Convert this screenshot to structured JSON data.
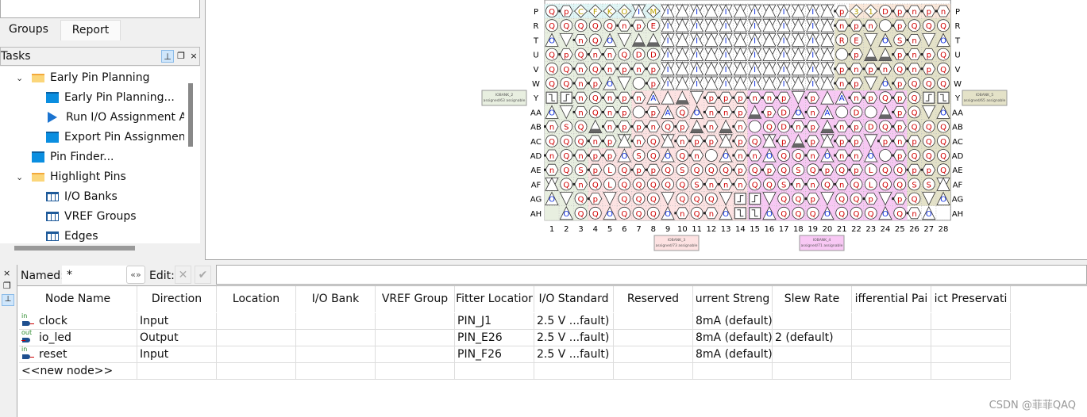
{
  "left_panel": {
    "tabs": [
      {
        "label": "Groups"
      },
      {
        "label": "Report",
        "active": true
      }
    ],
    "tasks": {
      "title": "Tasks",
      "items": [
        {
          "label": "Early Pin Planning",
          "icon": "folder-icon",
          "expanded": true,
          "level": 1
        },
        {
          "label": "Early Pin Planning...",
          "icon": "window-icon",
          "level": 2
        },
        {
          "label": "Run I/O Assignment A",
          "icon": "play-icon",
          "level": 2
        },
        {
          "label": "Export Pin Assignmen",
          "icon": "window-icon",
          "level": 2
        },
        {
          "label": "Pin Finder...",
          "icon": "window-icon",
          "level": 1
        },
        {
          "label": "Highlight Pins",
          "icon": "folder-icon",
          "expanded": true,
          "level": 1
        },
        {
          "label": "I/O Banks",
          "icon": "table-icon",
          "level": 2
        },
        {
          "label": "VREF Groups",
          "icon": "table-icon",
          "level": 2
        },
        {
          "label": "Edges",
          "icon": "table-icon",
          "level": 2
        }
      ]
    }
  },
  "package": {
    "row_labels": [
      "P",
      "R",
      "T",
      "U",
      "V",
      "W",
      "Y",
      "AA",
      "AB",
      "AC",
      "AD",
      "AE",
      "AF",
      "AG",
      "AH"
    ],
    "col_labels": [
      "1",
      "2",
      "3",
      "4",
      "5",
      "6",
      "7",
      "8",
      "9",
      "10",
      "11",
      "12",
      "13",
      "14",
      "15",
      "16",
      "17",
      "18",
      "19",
      "20",
      "21",
      "22",
      "23",
      "24",
      "25",
      "26",
      "27",
      "28"
    ],
    "rows": [
      "Q p C F K O I M I X I X I X I X I X I X p 3 1 D p n p n",
      "Q Q Q Q Q n p E I X I X I X I X I X I X n p n o p Q Q Q",
      "O^ v n Q O^ v T T I X I X I X I X I X I X R E v O^ S n v O^",
      "Q p Q n n Q D D I X I X I X I X I X I X o p T T p n p Q",
      "Q Q n Q n p n p I X I X I X I X I X I X p n p n Q n p Q",
      "Q Q n p O^ v o p I X I X I X I X I X I X n p v O^ p Q Q Q",
      "Cf Cr n Q n p n A^ ^ T v p p p n n p v p ^ A^ n p Q p Q Cr Cf",
      "O^ v n Q n p o p A^ Q O^ n n p T p D O^ n A^ o D o T p Q v O^",
      "n S Q T n p p n Q p T n T n o Q D n p T n p D Q p Q Q Q",
      "Q Q Q n p X n Q X n p p X p Q X p T p X p p v p n p Q Q",
      "n Q n p p O^ S Q O^ Q n o O^ n n O^ Q Q n O^ n n O^ o p Q Q Q",
      "n Q S p L Q p p Q S Q Q Q p Q p Q S Q p Q p L Q Q p p Q",
      "X Q n Q L Q Q Q Q Q S n n n Q Q S n n Q n Q L Q Q S S X",
      "O^ v Q p v Q Q Q v Q Q Q v Cr Cr v Q Q p v Q Q p v p Q v O^",
      "_ O^ Q Q O^ Q Q Q O^ n Q n O^ Cf Cf O^ Q Q Q O^ Q Q Q O^ Q n O^ _"
    ],
    "banks": [
      {
        "name": "IOBANK_2",
        "status": "assigned/63 assignable",
        "color": "#e8efe0"
      },
      {
        "name": "IOBANK_5",
        "status": "assigned/65 assignable",
        "color": "#e4e2c8"
      },
      {
        "name": "IOBANK_3",
        "status": "assigned/73 assignable",
        "color": "#fde2e2"
      },
      {
        "name": "IOBANK_4",
        "status": "assigned/71 assignable",
        "color": "#f8c8f4"
      }
    ],
    "colors": {
      "Q": "#d00000",
      "io_letter": "#d00000",
      "O": "#1030e0",
      "special": "#b8a000",
      "top_left": "#dff5f5",
      "top_right": "#f9e6d8"
    }
  },
  "bottom": {
    "toolbar": {
      "named_label": "Named:",
      "named_value": "*",
      "edit_label": "Edit:"
    },
    "columns": [
      "Node Name",
      "Direction",
      "Location",
      "I/O Bank",
      "VREF Group",
      "Fitter Locatior",
      "I/O Standard",
      "Reserved",
      "urrent Streng",
      "Slew Rate",
      "ifferential Pai",
      "ict Preservati"
    ],
    "rows": [
      {
        "dir_tag": "in",
        "cells": [
          "clock",
          "Input",
          "",
          "",
          "",
          "PIN_J1",
          "2.5 V ...fault)",
          "",
          "8mA (default)",
          "",
          "",
          ""
        ]
      },
      {
        "dir_tag": "out",
        "cells": [
          "io_led",
          "Output",
          "",
          "",
          "",
          "PIN_E26",
          "2.5 V ...fault)",
          "",
          "8mA (default)",
          "2 (default)",
          "",
          ""
        ]
      },
      {
        "dir_tag": "in",
        "cells": [
          "reset",
          "Input",
          "",
          "",
          "",
          "PIN_F26",
          "2.5 V ...fault)",
          "",
          "8mA (default)",
          "",
          "",
          ""
        ]
      },
      {
        "dir_tag": "",
        "cells": [
          "<<new node>>",
          "",
          "",
          "",
          "",
          "",
          "",
          "",
          "",
          "",
          "",
          ""
        ]
      }
    ]
  },
  "watermark": "CSDN @菲菲QAQ"
}
